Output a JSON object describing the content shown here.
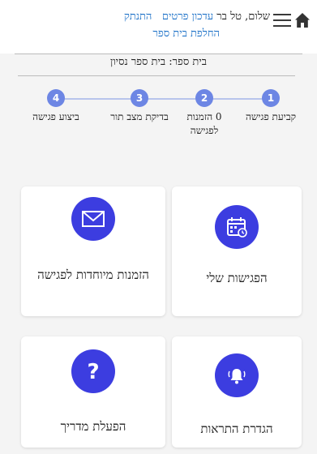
{
  "header": {
    "greeting": "שלום, טל בר",
    "update_details_link": "עדכון פרטים",
    "logout_link": "התנתק",
    "switch_school_link": "החלפת בית ספר",
    "menu_icon": "hamburger-menu-icon",
    "home_icon": "home-icon"
  },
  "school": {
    "label": "בית ספר: בית ספר נסיון"
  },
  "steps": [
    {
      "number": "1",
      "label": "קביעת פגישה"
    },
    {
      "number": "2",
      "label": "0 הזמנות לפגישה"
    },
    {
      "number": "3",
      "label": "בדיקת מצב תור"
    },
    {
      "number": "4",
      "label": "ביצוע פגישה"
    }
  ],
  "cards": {
    "my_meetings": "הפגישות שלי",
    "special_invites": "הזמנות מיוחדות לפגישה",
    "notifications": "הגדרת התראות",
    "guide": "הפעלת מדריך"
  },
  "colors": {
    "accent": "#3c3de0",
    "step_circle": "#6d86e4",
    "link": "#1e72c8"
  }
}
